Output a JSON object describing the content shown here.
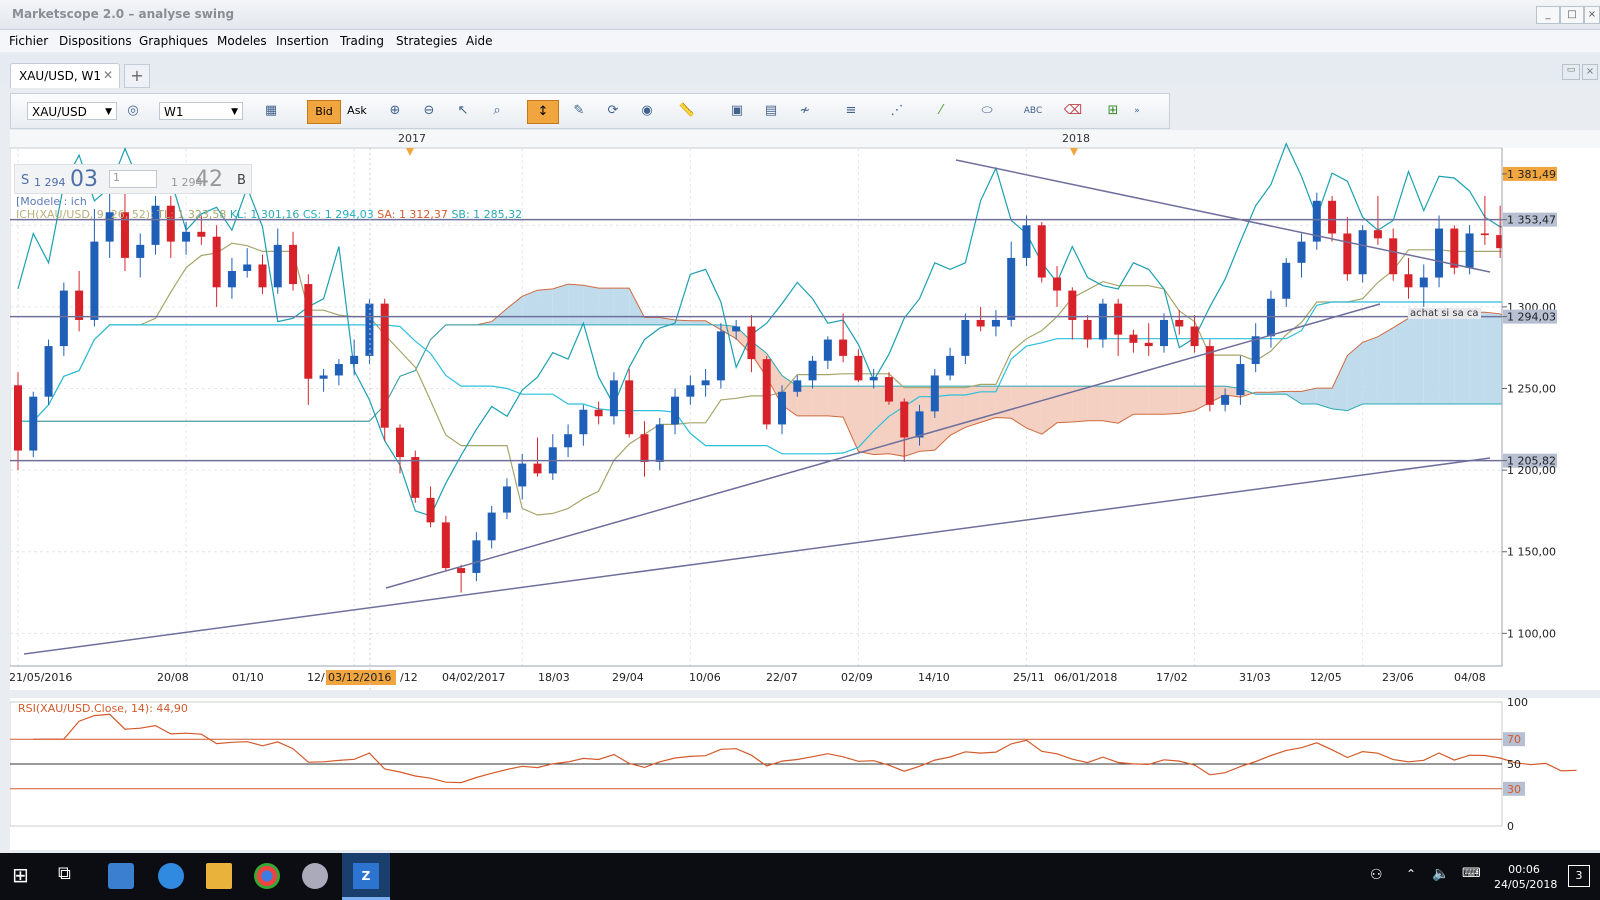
{
  "window": {
    "title": "Marketscope 2.0 – analyse swing"
  },
  "menu": [
    "Fichier",
    "Dispositions",
    "Graphiques",
    "Modeles",
    "Insertion",
    "Trading",
    "Strategies",
    "Aide"
  ],
  "tabs": [
    {
      "label": "XAU/USD, W1"
    }
  ],
  "toolbar": {
    "symbol": "XAU/USD",
    "timeframe": "W1",
    "bid_label": "Bid",
    "ask_label": "Ask"
  },
  "quote": {
    "sell_prefix": "S",
    "sell_small": "1 294",
    "sell_big": "03",
    "amount": "1",
    "buy_small": "1 294",
    "buy_big": "42",
    "buy_prefix": "B"
  },
  "legend": {
    "modele": "[Modele : ich",
    "ichimoku_name": "ICH(XAU/USD, 9, 26, 52):",
    "tl": "TL: 1 323,58",
    "kl": "KL: 1 301,16",
    "cs": "CS: 1 294,03",
    "sa": "SA: 1 312,37",
    "sb": "SB: 1 285,32",
    "rsi": "RSI(XAU/USD.Close, 14): 44,90"
  },
  "years": [
    "2017",
    "2018"
  ],
  "price_labels": [
    "1 381,49",
    "1 353,47",
    "1 300,00",
    "1 294,03",
    "1 250,00",
    "1 205,82",
    "1 200,00",
    "1 150,00",
    "1 100,00"
  ],
  "date_labels": [
    "21/05/2016",
    "20/08",
    "01/10",
    "12/",
    "03/12/2016",
    "/12",
    "04/02/2017",
    "18/03",
    "29/04",
    "10/06",
    "22/07",
    "02/09",
    "14/10",
    "25/11",
    "06/01/2018",
    "17/02",
    "31/03",
    "12/05",
    "23/06",
    "04/08"
  ],
  "annotation": "achat si sa ca",
  "rsi_levels": [
    "100",
    "70",
    "50",
    "30",
    "0"
  ],
  "taskbar": {
    "time": "00:06",
    "date": "24/05/2018",
    "notifications": "3"
  },
  "colors": {
    "up": "#1f5fb8",
    "down": "#d8222a",
    "kijun": "#2aa8b5",
    "tenkan": "#a7a56a",
    "chikou": "#1aa0b0",
    "cloud_bull": "#b9d8ea",
    "cloud_bear": "#f2cbbb",
    "span_a": "#cf6a3f",
    "trendline": "#6f6f9c",
    "accent": "#f0a53f"
  },
  "chart_data": {
    "type": "candlestick",
    "x": [
      "21/05/2016",
      "28/05/2016",
      "04/06/2016",
      "11/06/2016",
      "18/06/2016",
      "25/06/2016",
      "02/07/2016",
      "09/07/2016",
      "16/07/2016",
      "23/07/2016",
      "30/07/2016",
      "06/08/2016",
      "13/08/2016",
      "20/08/2016",
      "27/08/2016",
      "03/09/2016",
      "10/09/2016",
      "17/09/2016",
      "24/09/2016",
      "01/10/2016",
      "08/10/2016",
      "15/10/2016",
      "22/10/2016",
      "29/10/2016",
      "05/11/2016",
      "12/11/2016",
      "19/11/2016",
      "26/11/2016",
      "03/12/2016",
      "10/12/2016",
      "17/12/2016",
      "24/12/2016",
      "31/12/2016",
      "07/01/2017",
      "14/01/2017",
      "21/01/2017",
      "28/01/2017",
      "04/02/2017",
      "11/02/2017",
      "18/02/2017",
      "25/02/2017",
      "04/03/2017",
      "11/03/2017",
      "18/03/2017",
      "25/03/2017",
      "01/04/2017",
      "08/04/2017",
      "15/04/2017",
      "22/04/2017",
      "29/04/2017",
      "06/05/2017",
      "13/05/2017",
      "20/05/2017",
      "27/05/2017",
      "03/06/2017",
      "10/06/2017",
      "17/06/2017",
      "24/06/2017",
      "01/07/2017",
      "08/07/2017",
      "15/07/2017",
      "22/07/2017",
      "29/07/2017",
      "05/08/2017",
      "12/08/2017",
      "19/08/2017",
      "26/08/2017",
      "02/09/2017",
      "09/09/2017",
      "16/09/2017",
      "23/09/2017",
      "30/09/2017",
      "07/10/2017",
      "14/10/2017",
      "21/10/2017",
      "28/10/2017",
      "04/11/2017",
      "11/11/2017",
      "18/11/2017",
      "25/11/2017",
      "02/12/2017",
      "09/12/2017",
      "16/12/2017",
      "23/12/2017",
      "30/12/2017",
      "06/01/2018",
      "13/01/2018",
      "20/01/2018",
      "27/01/2018",
      "03/02/2018",
      "10/02/2018",
      "17/02/2018",
      "24/02/2018",
      "03/03/2018",
      "10/03/2018",
      "17/03/2018",
      "24/03/2018",
      "31/03/2018",
      "07/04/2018",
      "14/04/2018",
      "21/04/2018",
      "28/04/2018",
      "05/05/2018",
      "12/05/2018",
      "19/05/2018"
    ],
    "ohlc": [
      [
        1252,
        1260,
        1200,
        1212
      ],
      [
        1212,
        1248,
        1208,
        1245
      ],
      [
        1245,
        1280,
        1240,
        1276
      ],
      [
        1276,
        1315,
        1270,
        1310
      ],
      [
        1310,
        1322,
        1285,
        1292
      ],
      [
        1292,
        1360,
        1288,
        1340
      ],
      [
        1340,
        1378,
        1330,
        1358
      ],
      [
        1358,
        1375,
        1322,
        1330
      ],
      [
        1330,
        1345,
        1318,
        1338
      ],
      [
        1338,
        1368,
        1332,
        1362
      ],
      [
        1362,
        1368,
        1330,
        1340
      ],
      [
        1340,
        1352,
        1332,
        1346
      ],
      [
        1346,
        1356,
        1338,
        1343
      ],
      [
        1343,
        1350,
        1300,
        1312
      ],
      [
        1312,
        1330,
        1305,
        1322
      ],
      [
        1322,
        1336,
        1318,
        1326
      ],
      [
        1326,
        1332,
        1308,
        1312
      ],
      [
        1312,
        1348,
        1308,
        1338
      ],
      [
        1338,
        1346,
        1310,
        1314
      ],
      [
        1314,
        1320,
        1240,
        1256
      ],
      [
        1256,
        1262,
        1248,
        1258
      ],
      [
        1258,
        1268,
        1252,
        1265
      ],
      [
        1265,
        1280,
        1258,
        1270
      ],
      [
        1270,
        1305,
        1265,
        1302
      ],
      [
        1302,
        1305,
        1218,
        1226
      ],
      [
        1226,
        1228,
        1198,
        1208
      ],
      [
        1208,
        1212,
        1180,
        1183
      ],
      [
        1183,
        1190,
        1165,
        1168
      ],
      [
        1168,
        1172,
        1138,
        1140
      ],
      [
        1140,
        1142,
        1125,
        1137
      ],
      [
        1137,
        1162,
        1132,
        1157
      ],
      [
        1157,
        1178,
        1152,
        1174
      ],
      [
        1174,
        1195,
        1170,
        1190
      ],
      [
        1190,
        1210,
        1182,
        1204
      ],
      [
        1204,
        1220,
        1196,
        1198
      ],
      [
        1198,
        1222,
        1194,
        1214
      ],
      [
        1214,
        1228,
        1208,
        1222
      ],
      [
        1222,
        1240,
        1215,
        1237
      ],
      [
        1237,
        1242,
        1228,
        1233
      ],
      [
        1233,
        1260,
        1228,
        1255
      ],
      [
        1255,
        1262,
        1220,
        1222
      ],
      [
        1222,
        1230,
        1196,
        1205
      ],
      [
        1205,
        1232,
        1200,
        1228
      ],
      [
        1228,
        1250,
        1222,
        1245
      ],
      [
        1245,
        1258,
        1240,
        1252
      ],
      [
        1252,
        1262,
        1245,
        1255
      ],
      [
        1255,
        1290,
        1250,
        1285
      ],
      [
        1285,
        1292,
        1280,
        1288
      ],
      [
        1288,
        1295,
        1260,
        1268
      ],
      [
        1268,
        1270,
        1225,
        1228
      ],
      [
        1228,
        1252,
        1222,
        1248
      ],
      [
        1248,
        1258,
        1245,
        1255
      ],
      [
        1255,
        1270,
        1250,
        1267
      ],
      [
        1267,
        1282,
        1262,
        1280
      ],
      [
        1280,
        1296,
        1266,
        1270
      ],
      [
        1270,
        1274,
        1254,
        1255
      ],
      [
        1255,
        1262,
        1250,
        1257
      ],
      [
        1257,
        1260,
        1240,
        1242
      ],
      [
        1242,
        1244,
        1205,
        1220
      ],
      [
        1220,
        1240,
        1215,
        1236
      ],
      [
        1236,
        1262,
        1232,
        1258
      ],
      [
        1258,
        1275,
        1255,
        1270
      ],
      [
        1270,
        1296,
        1265,
        1292
      ],
      [
        1292,
        1300,
        1285,
        1288
      ],
      [
        1288,
        1298,
        1282,
        1292
      ],
      [
        1292,
        1340,
        1288,
        1330
      ],
      [
        1330,
        1356,
        1325,
        1350
      ],
      [
        1350,
        1352,
        1315,
        1318
      ],
      [
        1318,
        1325,
        1300,
        1310
      ],
      [
        1310,
        1312,
        1280,
        1292
      ],
      [
        1292,
        1295,
        1275,
        1280
      ],
      [
        1280,
        1305,
        1275,
        1302
      ],
      [
        1302,
        1305,
        1270,
        1283
      ],
      [
        1283,
        1286,
        1272,
        1278
      ],
      [
        1278,
        1290,
        1270,
        1276
      ],
      [
        1276,
        1296,
        1272,
        1292
      ],
      [
        1292,
        1298,
        1283,
        1288
      ],
      [
        1288,
        1295,
        1272,
        1276
      ],
      [
        1276,
        1280,
        1236,
        1240
      ],
      [
        1240,
        1250,
        1236,
        1246
      ],
      [
        1246,
        1270,
        1240,
        1265
      ],
      [
        1265,
        1290,
        1260,
        1282
      ],
      [
        1282,
        1310,
        1275,
        1305
      ],
      [
        1305,
        1330,
        1300,
        1327
      ],
      [
        1327,
        1345,
        1318,
        1340
      ],
      [
        1340,
        1370,
        1335,
        1365
      ],
      [
        1365,
        1368,
        1340,
        1345
      ],
      [
        1345,
        1355,
        1316,
        1320
      ],
      [
        1320,
        1350,
        1315,
        1347
      ],
      [
        1347,
        1368,
        1338,
        1342
      ],
      [
        1342,
        1348,
        1316,
        1320
      ],
      [
        1320,
        1330,
        1305,
        1312
      ],
      [
        1312,
        1326,
        1300,
        1318
      ],
      [
        1318,
        1356,
        1312,
        1348
      ],
      [
        1348,
        1350,
        1320,
        1324
      ],
      [
        1324,
        1350,
        1320,
        1345
      ],
      [
        1345,
        1368,
        1338,
        1344
      ],
      [
        1344,
        1362,
        1330,
        1336
      ],
      [
        1336,
        1340,
        1316,
        1320
      ],
      [
        1320,
        1325,
        1305,
        1314
      ],
      [
        1314,
        1322,
        1300,
        1318
      ],
      [
        1318,
        1320,
        1286,
        1292
      ],
      [
        1292,
        1300,
        1285,
        1294
      ]
    ],
    "ylim": [
      1080,
      1390
    ],
    "horizontal_levels": [
      1353.47,
      1294.03,
      1205.82
    ],
    "rsi": {
      "name": "RSI(XAU/USD.Close, 14)",
      "last": 44.9,
      "levels": [
        70,
        50,
        30
      ],
      "ylim": [
        0,
        100
      ]
    }
  }
}
